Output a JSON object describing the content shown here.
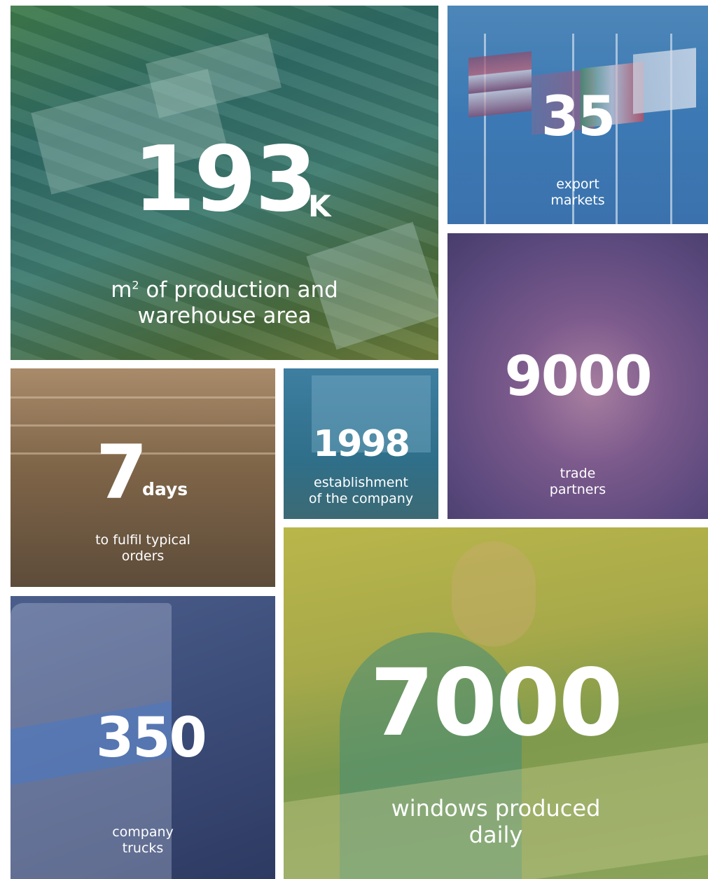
{
  "stats": {
    "area": {
      "value": "193",
      "suffix": "K",
      "unit": "m",
      "unit_sup": "2",
      "label_line1": " of production and",
      "label_line2": "warehouse area"
    },
    "markets": {
      "value": "35",
      "label_line1": "export",
      "label_line2": "markets"
    },
    "partners": {
      "value": "9000",
      "label_line1": "trade",
      "label_line2": "partners"
    },
    "days": {
      "value": "7",
      "suffix": "days",
      "label_line1": "to fulfil typical",
      "label_line2": "orders"
    },
    "year": {
      "value": "1998",
      "label_line1": "establishment",
      "label_line2": "of the company"
    },
    "trucks": {
      "value": "350",
      "label_line1": "company",
      "label_line2": "trucks"
    },
    "windows": {
      "value": "7000",
      "label_line1": "windows produced",
      "label_line2": "daily"
    }
  },
  "colors": {
    "area_tint": "#2f6b66",
    "markets_tint": "#3c79b4",
    "partners_tint": "#6a4f88",
    "days_tint": "#7f6548",
    "year_tint": "#2f6f8a",
    "trucks_tint": "#3e4f7c",
    "windows_tint": "#a7a94a"
  }
}
